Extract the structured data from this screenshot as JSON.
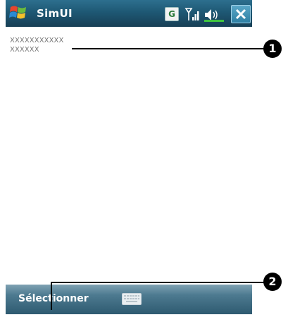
{
  "app": {
    "title": "SimUI"
  },
  "status_bar": {
    "g_indicator": "G",
    "icons": [
      "windows-logo-icon",
      "signal-icon",
      "speaker-icon",
      "close-icon"
    ]
  },
  "content": {
    "lines": [
      "XXXXXXXXXXX",
      "XXXXXX"
    ]
  },
  "menubar": {
    "left_softkey": "Sélectionner",
    "input_icon": "keyboard-icon"
  },
  "callouts": {
    "one": "1",
    "two": "2"
  },
  "colors": {
    "titlebar": "#1e5874",
    "menubar": "#4d7a90",
    "text_grey": "#777777"
  }
}
